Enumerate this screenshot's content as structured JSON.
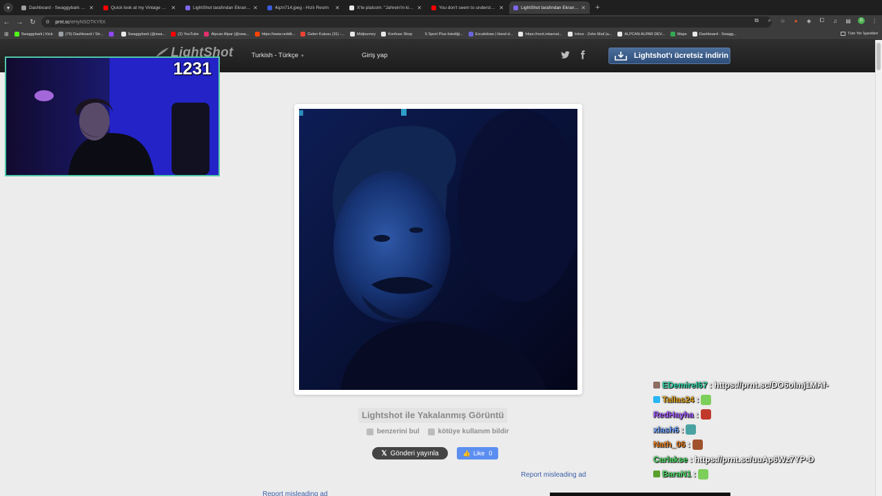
{
  "browser": {
    "tabs": [
      {
        "title": "Dashboard - Swaggybark Link",
        "color": "#9aa0a6",
        "active": false
      },
      {
        "title": "Quick look at my Vintage Story",
        "color": "#ff0000",
        "active": false
      },
      {
        "title": "LightShot tarafından Ekran Gör",
        "color": "#7b68ee",
        "active": false
      },
      {
        "title": "4qzn714.jpeg - Hızlı Resim",
        "color": "#3b5bdb",
        "active": false
      },
      {
        "title": "X'te platcom: \"Jahrein'in kişisel",
        "color": "#e8e8e8",
        "active": false
      },
      {
        "title": "You don't seem to understand",
        "color": "#ff0000",
        "active": false
      },
      {
        "title": "LightShot tarafından Ekran Gör",
        "color": "#7b68ee",
        "active": true
      }
    ],
    "url_host": "prnt.sc",
    "url_path": "/eHyNSOTKYftX",
    "bookmarks": [
      {
        "label": "Swaggybark | Kick",
        "color": "#53fc18"
      },
      {
        "label": "(79) Dashboard / Str...",
        "color": "#9aa0a6"
      },
      {
        "label": "",
        "color": "#9146ff"
      },
      {
        "label": "Swaggybark (@swa...",
        "color": "#e8e8e8"
      },
      {
        "label": "(2) YouTube",
        "color": "#ff0000"
      },
      {
        "label": "Alpcan Alpar (@swa...",
        "color": "#e1306c"
      },
      {
        "label": "https://www.reddit...",
        "color": "#ff4500"
      },
      {
        "label": "Gelen Kutusu (31) -...",
        "color": "#ea4335"
      },
      {
        "label": "Midjourney",
        "color": "#e8e8e8"
      },
      {
        "label": "Konfuse Shop",
        "color": "#e8e8e8"
      },
      {
        "label": "S Sport Plus-İstediği...",
        "color": "#3c3c3c"
      },
      {
        "label": "Excalidraw | Hand-d...",
        "color": "#6965db"
      },
      {
        "label": "https://next.inkarnat...",
        "color": "#e8e8e8"
      },
      {
        "label": "Inbox - Zoho Mail (a...",
        "color": "#e8e8e8"
      },
      {
        "label": "ALPCAN ALPAR DEV...",
        "color": "#e8e8e8"
      },
      {
        "label": "Maps",
        "color": "#34a853"
      },
      {
        "label": "Dashboard - Swagg...",
        "color": "#e8e8e8"
      }
    ],
    "all_bookmarks": "Tüm Yer İşaretleri"
  },
  "lightshot": {
    "logo": "LightShot",
    "language": "Turkish - Türkçe",
    "login": "Giriş yap",
    "download": "Lightshot'ı ücretsiz indirin",
    "caption": "Lightshot ile Yakalanmış Görüntü",
    "find_similar": "benzerini bul",
    "report_abuse": "kötüye kullanım bildir",
    "tweet": "Gönderi yayınla",
    "like": "Like",
    "like_count": "0",
    "report_ad_1": "Report misleading ad",
    "report_ad_2": "Report misleading ad"
  },
  "stream": {
    "viewer_count": "1231",
    "chat": [
      {
        "user": "EDemirel67",
        "user_color": "#2dd4a7",
        "message": "https://prnt.sc/DO6olmj1MAf-",
        "badge": "#8d6e63",
        "emote": null
      },
      {
        "user": "Tallas24",
        "user_color": "#e0a21c",
        "message": "",
        "badge": "#29b6f6",
        "emote": "#7ccf5a"
      },
      {
        "user": "RedHayha",
        "user_color": "#a259ff",
        "message": "",
        "badge": null,
        "emote": "#c0392b"
      },
      {
        "user": "xlash6",
        "user_color": "#6ea0ff",
        "message": "",
        "badge": null,
        "emote": "#4aa3a3"
      },
      {
        "user": "Nath_06",
        "user_color": "#e67e22",
        "message": "",
        "badge": null,
        "emote": "#a0522d"
      },
      {
        "user": "Carlakse",
        "user_color": "#4cd964",
        "message": "https://prnt.sc/uuAp6Wz7YP-D",
        "badge": null,
        "emote": null
      },
      {
        "user": "BaraN1",
        "user_color": "#4cd964",
        "message": "",
        "badge": "#5aa02c",
        "emote": "#7ccf5a"
      }
    ]
  }
}
